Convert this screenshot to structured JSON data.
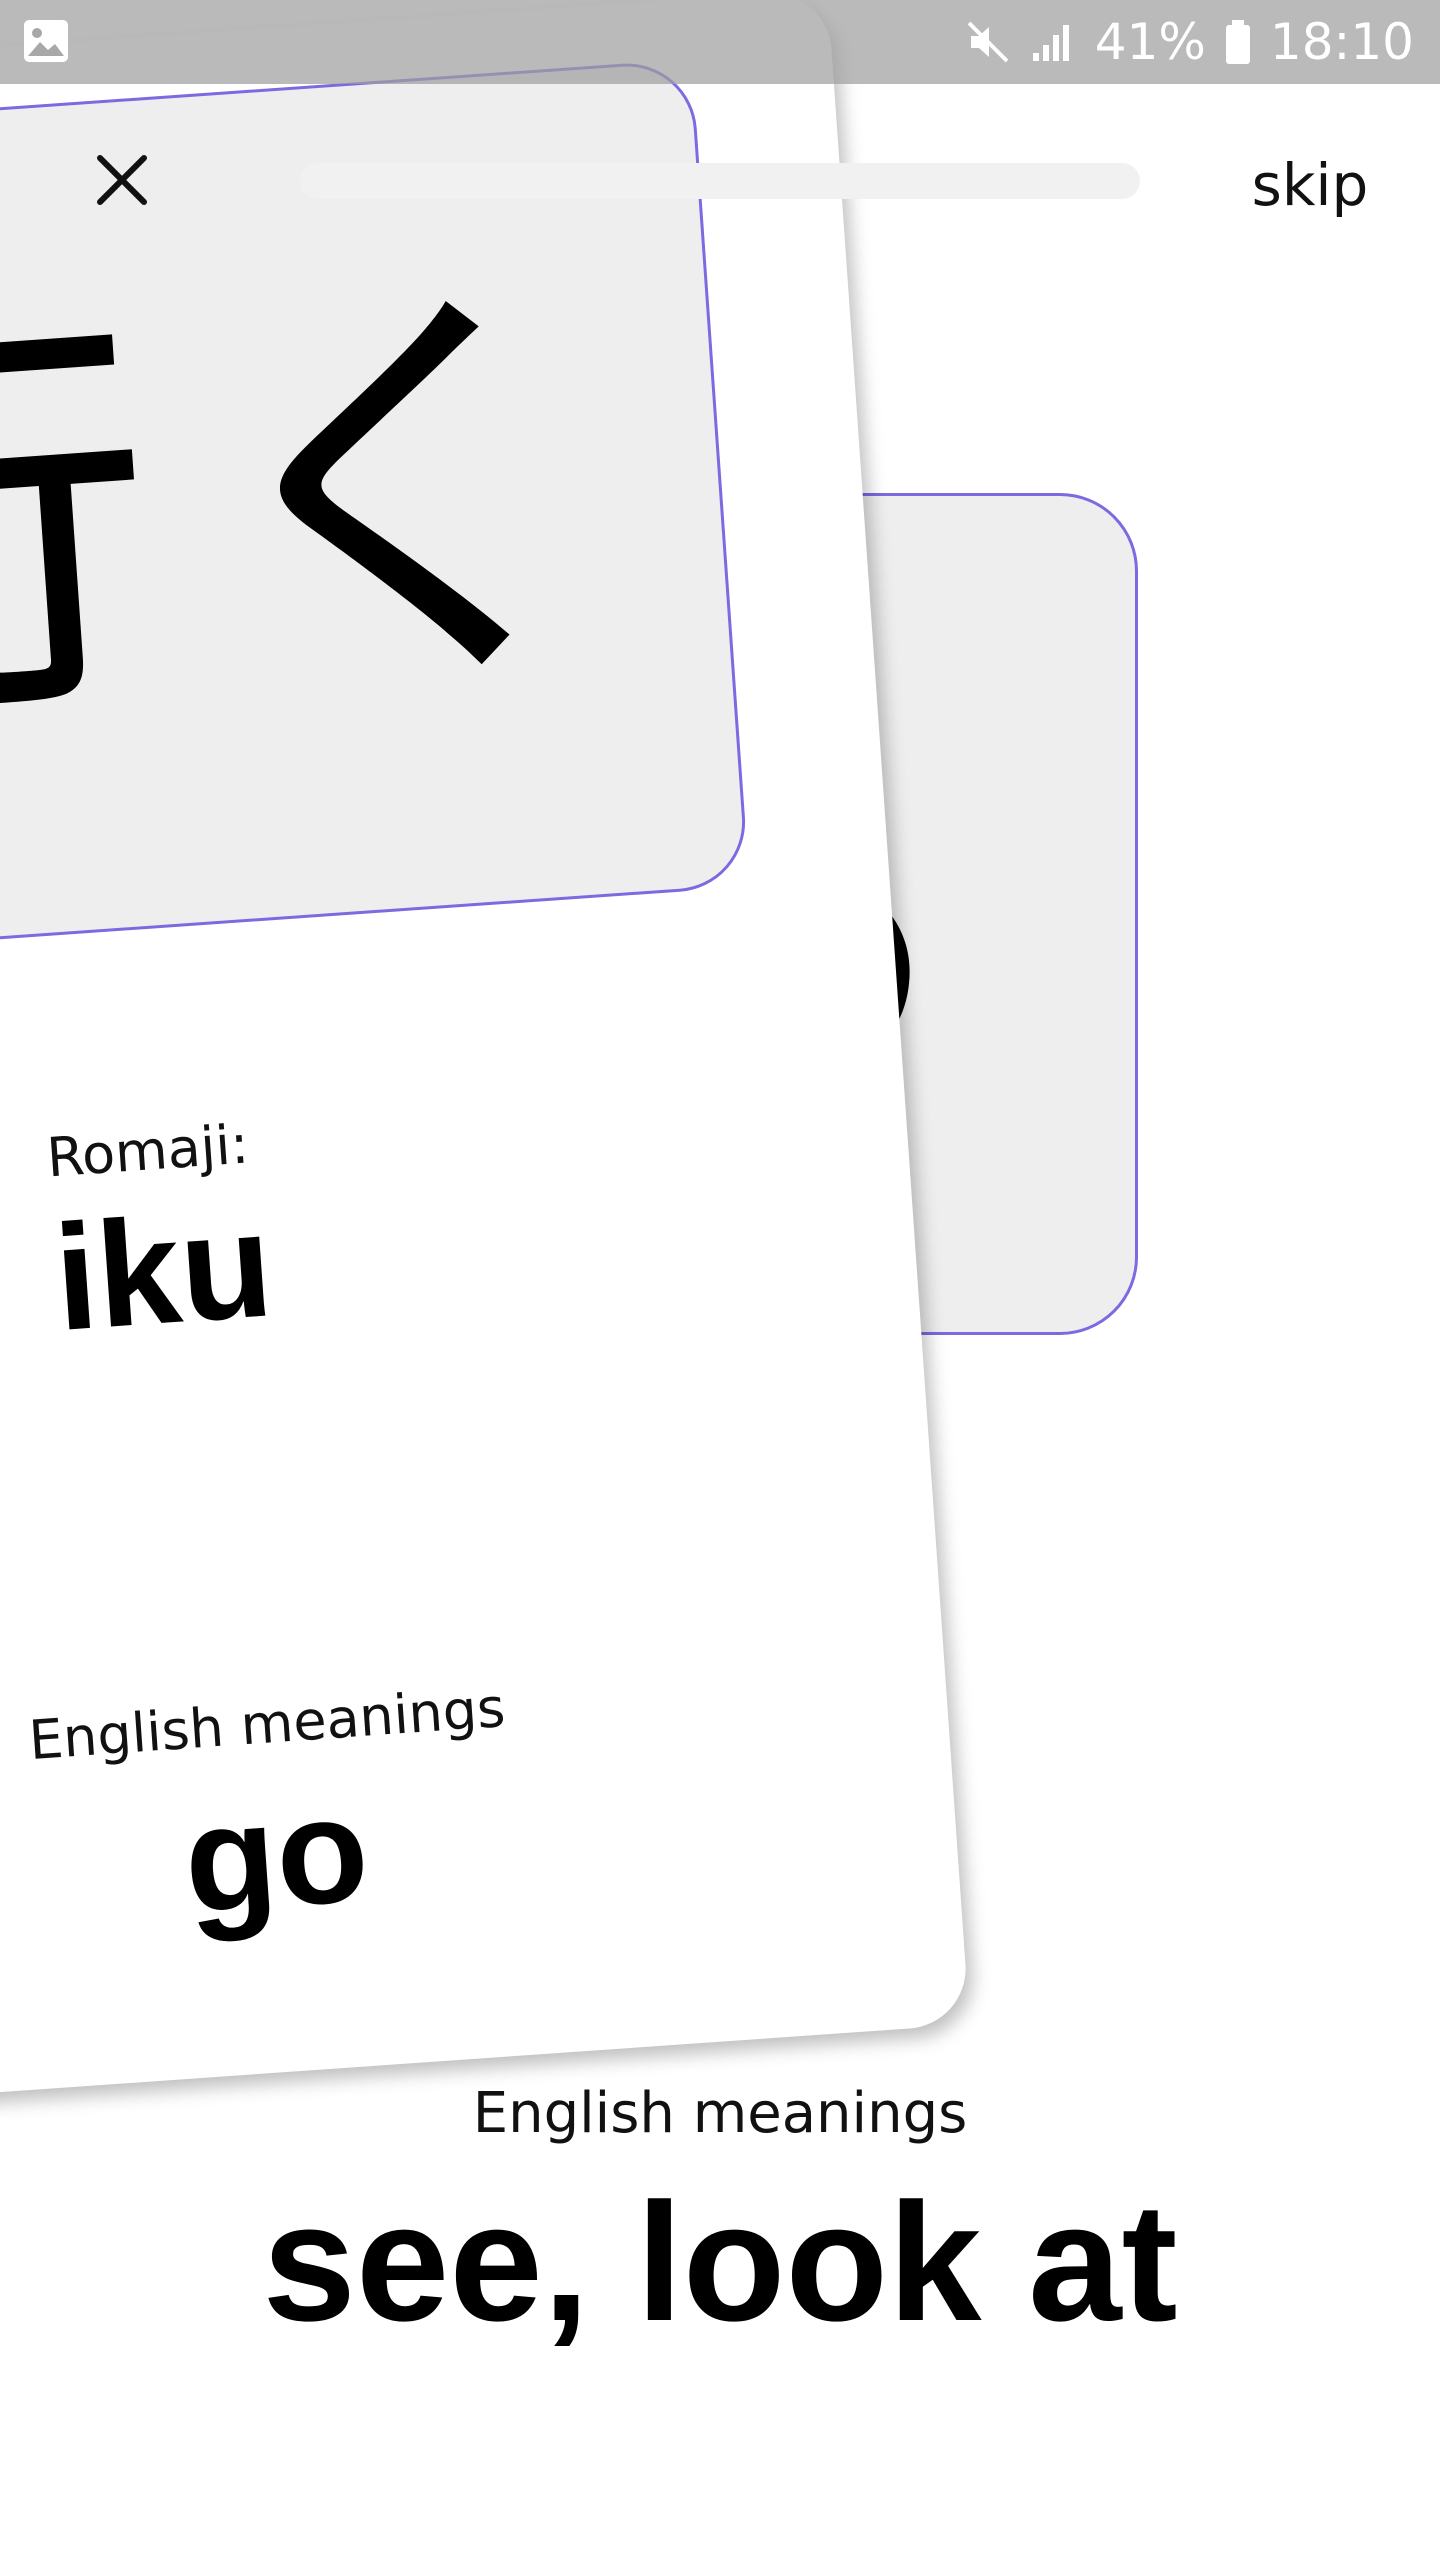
{
  "status_bar": {
    "time": "18:10",
    "battery_percent": "41%",
    "icons": [
      "image-icon",
      "mute-icon",
      "signal-icon",
      "battery-icon"
    ]
  },
  "header": {
    "close_icon": "close-icon",
    "progress_fraction": 0.0,
    "skip_label": "skip"
  },
  "front_card": {
    "kana": "行く",
    "romaji_label": "Romaji:",
    "romaji": "iku",
    "meaning_label": "English meanings",
    "meaning": "go"
  },
  "back_card": {
    "kana": "る",
    "meaning_label": "English meanings",
    "meaning": "see, look at"
  },
  "colors": {
    "accent": "#7b6ae0",
    "card_box": "#eeeeee",
    "status_bar": "#a0a0a0"
  }
}
